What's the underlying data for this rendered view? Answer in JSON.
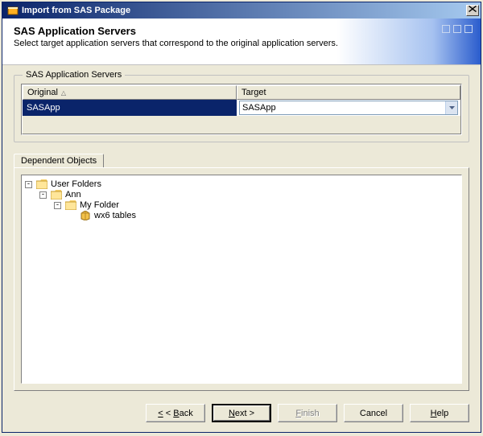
{
  "window": {
    "title": "Import from SAS Package"
  },
  "banner": {
    "heading": "SAS Application Servers",
    "subtext": "Select target application servers that correspond to the original application servers."
  },
  "serversGroup": {
    "legend": "SAS Application Servers",
    "columns": {
      "original": "Original",
      "target": "Target"
    },
    "row": {
      "original": "SASApp",
      "target": "SASApp"
    }
  },
  "dependentTab": {
    "label": "Dependent Objects"
  },
  "tree": {
    "root": "User Folders",
    "ann": "Ann",
    "myfolder": "My Folder",
    "wx6": "wx6 tables"
  },
  "buttons": {
    "back": "< Back",
    "next": "Next >",
    "finish": "Finish",
    "cancel": "Cancel",
    "help": "Help"
  }
}
